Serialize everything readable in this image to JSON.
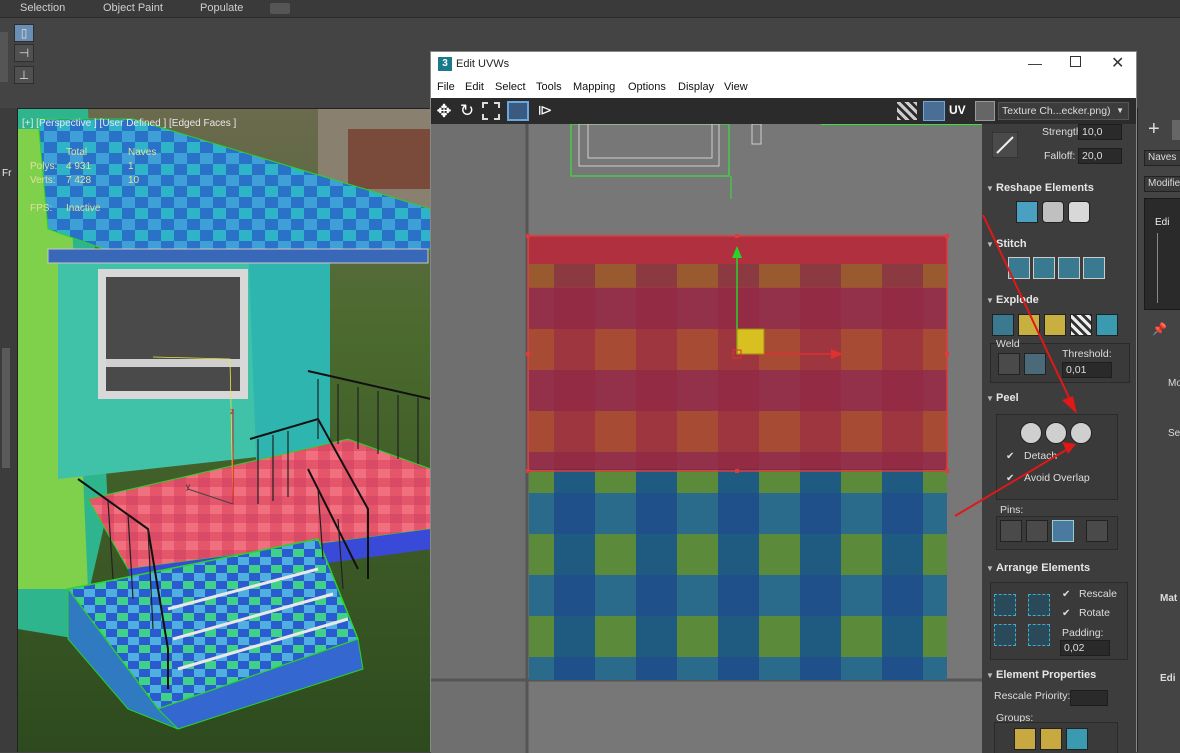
{
  "topbar": {
    "menu": [
      "Selection",
      "Object Paint",
      "Populate"
    ]
  },
  "viewport": {
    "label": "[+] [Perspective ] [User Defined ] [Edged Faces ]",
    "stats": {
      "total_header": "Total",
      "naves_header": "Naves",
      "polys_label": "Polys:",
      "polys_total": "4 931",
      "polys_naves": "1",
      "verts_label": "Verts:",
      "verts_total": "7 428",
      "verts_naves": "10",
      "fps_label": "FPS:",
      "fps_value": "Inactive"
    },
    "side_label": "Fr"
  },
  "uv_editor": {
    "title": "Edit UVWs",
    "title_icon": "3",
    "menu": [
      "File",
      "Edit",
      "Select",
      "Tools",
      "Mapping",
      "Options",
      "Display",
      "View"
    ],
    "uv_label": "UV",
    "texture_dropdown": "Texture Ch...ecker.png)"
  },
  "panel": {
    "strength_label": "Strength:",
    "strength_value": "10,0",
    "falloff_label": "Falloff:",
    "falloff_value": "20,0",
    "reshape_title": "Reshape Elements",
    "stitch_title": "Stitch",
    "explode_title": "Explode",
    "weld_label": "Weld",
    "threshold_label": "Threshold:",
    "threshold_value": "0,01",
    "peel_title": "Peel",
    "detach_label": "Detach",
    "avoid_overlap_label": "Avoid Overlap",
    "pins_label": "Pins:",
    "arrange_title": "Arrange Elements",
    "rescale_label": "Rescale",
    "rotate_label": "Rotate",
    "padding_label": "Padding:",
    "padding_value": "0,02",
    "element_props_title": "Element Properties",
    "rescale_priority_label": "Rescale Priority:",
    "groups_label": "Groups:"
  },
  "right_panel": {
    "naves_tab": "Naves",
    "modifier_label": "Modifier",
    "edit_label": "Edi",
    "mat_label": "Mat",
    "edit2_label": "Edi",
    "sel_label": "Sel",
    "mo_label": "Mo"
  },
  "colors": {
    "selection_red": "#d63a3a",
    "selection_green": "#35e635",
    "arrow_red": "#e01818"
  }
}
